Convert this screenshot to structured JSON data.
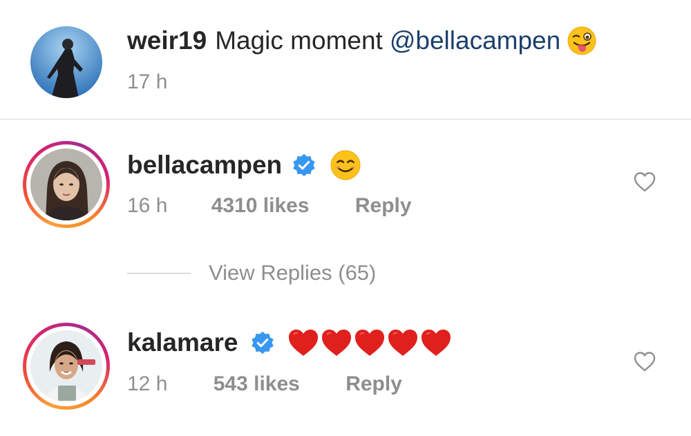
{
  "comments": [
    {
      "username": "weir19",
      "text": "Magic moment",
      "mention": "@bellacampen",
      "emoji": "winking-tongue-face",
      "time": "17 h"
    },
    {
      "username": "bellacampen",
      "verified": true,
      "emoji": "smiling-face",
      "time": "16 h",
      "likes": "4310 likes",
      "reply_label": "Reply",
      "view_replies": "View Replies (65)"
    },
    {
      "username": "kalamare",
      "verified": true,
      "emoji": "red-heart x5",
      "time": "12 h",
      "likes": "543 likes",
      "reply_label": "Reply"
    }
  ],
  "colors": {
    "text": "#262626",
    "meta": "#8e8e8e",
    "mention": "#1b3f6b",
    "verified": "#3897f0",
    "heart": "#e0201d"
  }
}
